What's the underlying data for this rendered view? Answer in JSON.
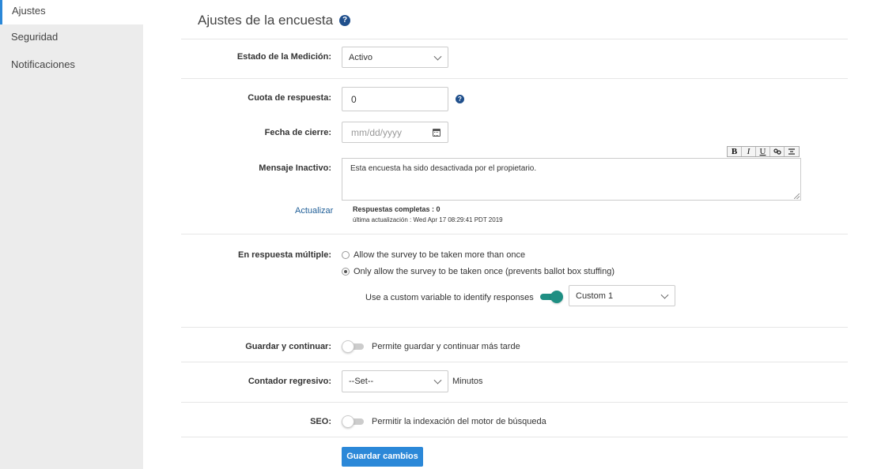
{
  "sidebar": {
    "items": [
      {
        "label": "Ajustes"
      },
      {
        "label": "Seguridad"
      },
      {
        "label": "Notificaciones"
      }
    ]
  },
  "page": {
    "title": "Ajustes de la encuesta"
  },
  "estado": {
    "label": "Estado de la Medición:",
    "value": "Activo"
  },
  "cuota": {
    "label": "Cuota de respuesta:",
    "value": "0"
  },
  "fecha": {
    "label": "Fecha de cierre:",
    "placeholder": "mm/dd/yyyy"
  },
  "mensaje": {
    "label": "Mensaje Inactivo:",
    "value": "Esta encuesta ha sido desactivada por el propietario.",
    "toolbar": {
      "bold": "B",
      "italic": "I",
      "underline": "U"
    }
  },
  "update": {
    "link": "Actualizar",
    "responses": "Respuestas completas : 0",
    "last_update": "última actualización : Wed Apr 17 08:29:41 PDT 2019"
  },
  "multiple": {
    "label": "En respuesta múltiple:",
    "option1": "Allow the survey to be taken more than once",
    "option2": "Only allow the survey to be taken once (prevents ballot box stuffing)",
    "custom_var_label": "Use a custom variable to identify responses",
    "custom_var_value": "Custom 1"
  },
  "guardar": {
    "label": "Guardar y continuar:",
    "text": "Permite guardar y continuar más tarde"
  },
  "contador": {
    "label": "Contador regresivo:",
    "value": "--Set--",
    "unit": "Minutos"
  },
  "seo": {
    "label": "SEO:",
    "text": "Permitir la indexación del motor de búsqueda"
  },
  "save_button": "Guardar cambios",
  "colors": {
    "accent": "#2b88d8",
    "toggle_on": "#1f8f83",
    "title_icon": "#1f4f8c"
  }
}
